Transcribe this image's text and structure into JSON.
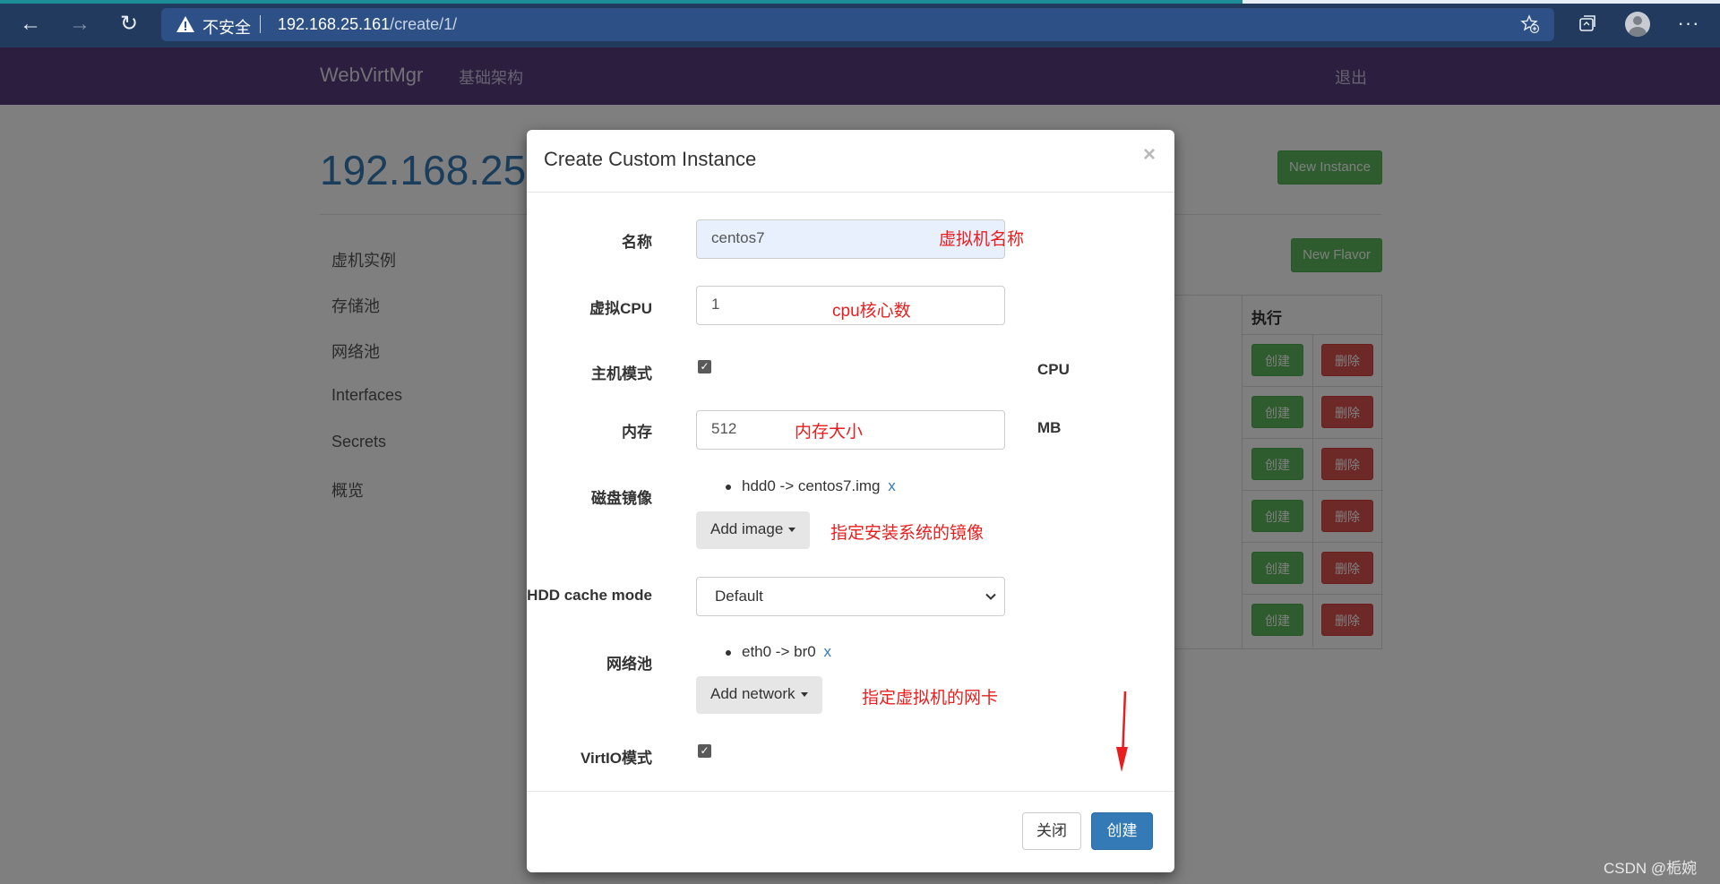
{
  "browser": {
    "insecure_label": "不安全",
    "url_host": "192.168.25.161",
    "url_path": "/create/1/",
    "more_label": "···"
  },
  "app": {
    "brand": "WebVirtMgr",
    "nav_infra": "基础架构",
    "nav_logout": "退出",
    "host_title": "192.168.25.",
    "sidebar": [
      "虚机实例",
      "存储池",
      "网络池",
      "Interfaces",
      "Secrets",
      "概览"
    ],
    "new_instance_label": "New Instance",
    "new_flavor_label": "New Flavor",
    "table_exec_header": "执行",
    "row_create_label": "创建",
    "row_delete_label": "删除"
  },
  "modal": {
    "title": "Create Custom Instance",
    "close_symbol": "×",
    "fields": {
      "name_label": "名称",
      "name_value": "centos7",
      "vcpu_label": "虚拟CPU",
      "vcpu_value": "1",
      "host_mode_label": "主机模式",
      "host_mode_suffix": "CPU",
      "host_mode_checked": true,
      "memory_label": "内存",
      "memory_value": "512",
      "memory_suffix": "MB",
      "disk_label": "磁盘镜像",
      "disk_item": "hdd0 -> centos7.img",
      "disk_remove": "x",
      "add_image_label": "Add image",
      "hdd_cache_label": "HDD cache mode",
      "hdd_cache_value": "Default",
      "network_label": "网络池",
      "network_item": "eth0 -> br0",
      "network_remove": "x",
      "add_network_label": "Add network",
      "virtio_label": "VirtIO模式",
      "virtio_checked": true
    },
    "footer": {
      "close_label": "关闭",
      "create_label": "创建"
    }
  },
  "annotations": {
    "name_hint": "虚拟机名称",
    "cpu_hint": "cpu核心数",
    "memory_hint": "内存大小",
    "image_hint": "指定安装系统的镜像",
    "network_hint": "指定虚拟机的网卡",
    "color": "#e81e1e"
  },
  "watermark": "CSDN @栀婉",
  "colors": {
    "navbar": "#563d7c",
    "primary": "#337ab7",
    "success": "#5cb85c",
    "danger": "#d9534f"
  }
}
